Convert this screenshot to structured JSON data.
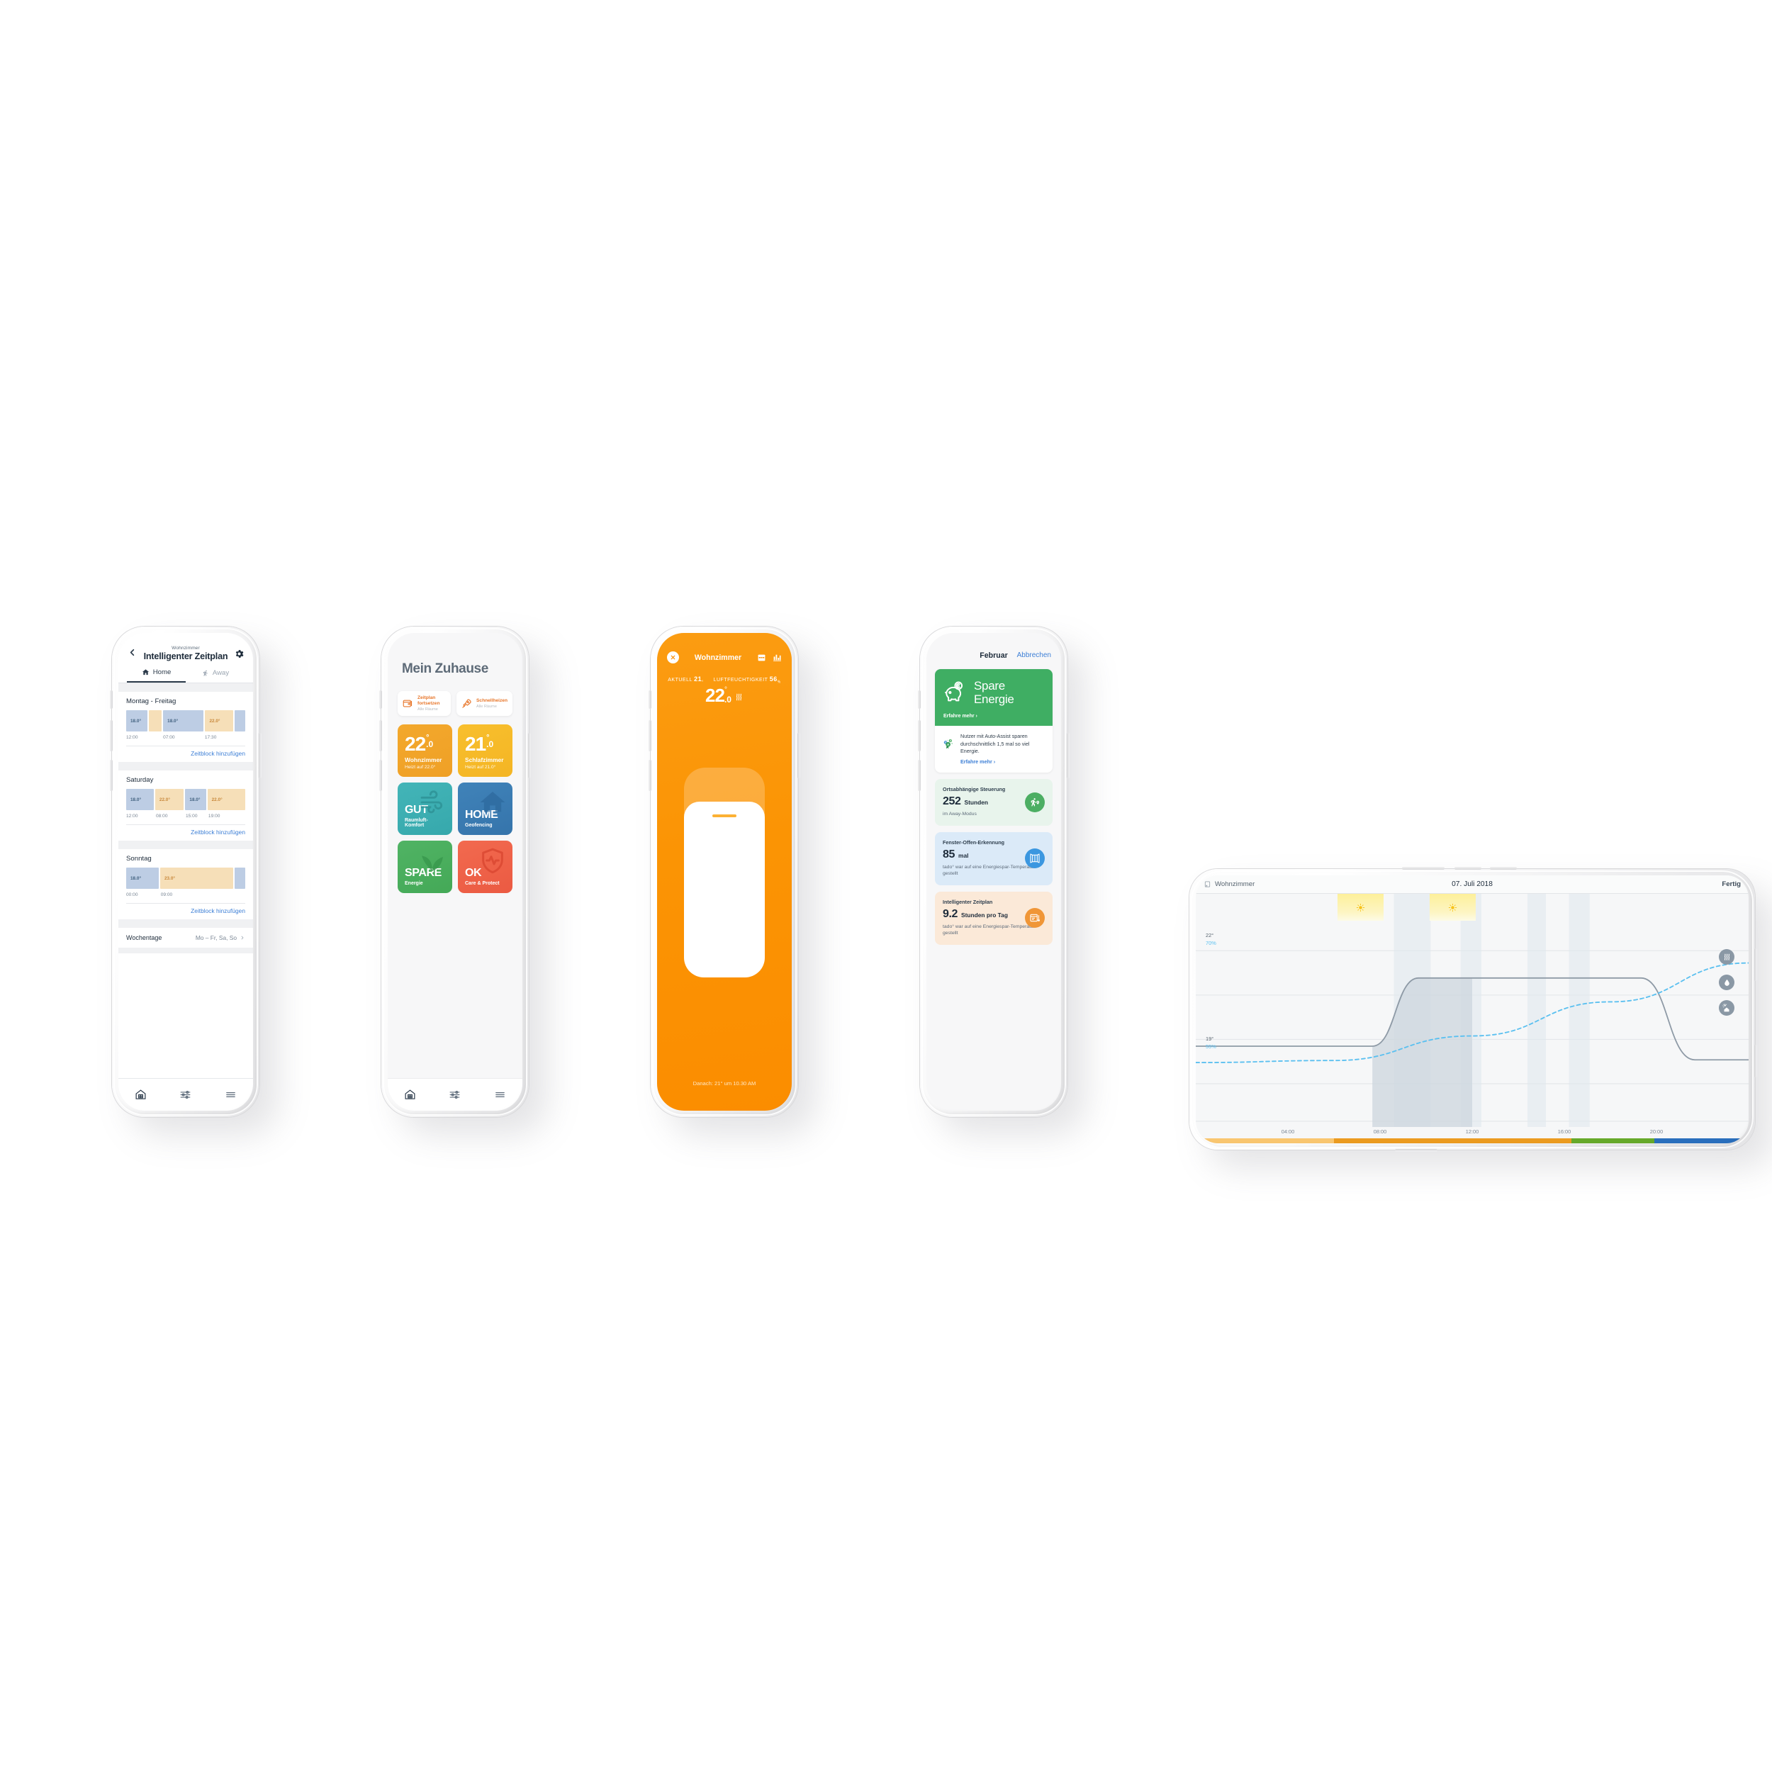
{
  "phone1": {
    "name": "smart-schedule-screen",
    "back_icon": "chevron-left-icon",
    "room": "Wohnzimmer",
    "title": "Intelligenter Zeitplan",
    "settings_icon": "gear-icon",
    "tabs": [
      {
        "label": "Home",
        "icon": "house-icon",
        "active": true
      },
      {
        "label": "Away",
        "icon": "walking-person-icon",
        "active": false
      }
    ],
    "add_block_label": "Zeitblock hinzufügen",
    "days": [
      {
        "day": "Montag - Freitag",
        "blocks": [
          {
            "temp": "18.0°",
            "kind": "cool",
            "width": 19
          },
          {
            "temp": "",
            "kind": "warm",
            "width": 11
          },
          {
            "temp": "18.0°",
            "kind": "cool",
            "width": 36
          },
          {
            "temp": "22.0°",
            "kind": "warm",
            "width": 25
          },
          {
            "temp": "",
            "kind": "cool",
            "width": 9
          }
        ],
        "times": [
          {
            "label": "12:00",
            "pos": 0
          },
          {
            "label": "07:00",
            "pos": 31
          },
          {
            "label": "17:30",
            "pos": 66
          }
        ]
      },
      {
        "day": "Saturday",
        "blocks": [
          {
            "temp": "18.0°",
            "kind": "cool",
            "width": 24
          },
          {
            "temp": "22.0°",
            "kind": "warm",
            "width": 25
          },
          {
            "temp": "18.0°",
            "kind": "cool",
            "width": 18
          },
          {
            "temp": "22.0°",
            "kind": "warm",
            "width": 33
          }
        ],
        "times": [
          {
            "label": "12:00",
            "pos": 0
          },
          {
            "label": "08:00",
            "pos": 25
          },
          {
            "label": "15:00",
            "pos": 50
          },
          {
            "label": "19:00",
            "pos": 69
          }
        ]
      },
      {
        "day": "Sonntag",
        "blocks": [
          {
            "temp": "18.0°",
            "kind": "cool",
            "width": 28
          },
          {
            "temp": "23.0°",
            "kind": "warm",
            "width": 63
          },
          {
            "temp": "",
            "kind": "cool",
            "width": 9
          }
        ],
        "times": [
          {
            "label": "00:00",
            "pos": 0
          },
          {
            "label": "09:00",
            "pos": 29
          }
        ]
      }
    ],
    "weekdays_row": {
      "label": "Wochentage",
      "value": "Mo – Fr, Sa, So",
      "chevron": "chevron-right-icon"
    },
    "tabbar": [
      {
        "icon": "home-building-icon",
        "active": true
      },
      {
        "icon": "sliders-icon",
        "active": false
      },
      {
        "icon": "menu-icon",
        "active": false
      }
    ]
  },
  "phone2": {
    "name": "my-home-screen",
    "title": "Mein Zuhause",
    "quick_actions": [
      {
        "icon": "resume-schedule-icon",
        "title": "Zeitplan fortsetzen",
        "subtitle": "Alle Räume"
      },
      {
        "icon": "rocket-icon",
        "title": "Schnellheizen",
        "subtitle": "Alle Räume"
      }
    ],
    "room_tiles": [
      {
        "temp_int": "22",
        "temp_dec": ".0",
        "deg": "°",
        "room": "Wohnzimmer",
        "sub": "Heizt auf 22.0°",
        "color": "#f2a229"
      },
      {
        "temp_int": "21",
        "temp_dec": ".0",
        "deg": "°",
        "room": "Schlafzimmer",
        "sub": "Heizt auf 21.0°",
        "color": "#f6b928"
      }
    ],
    "mode_tiles": [
      {
        "big": "GUT",
        "sub": "Raumluft-Komfort",
        "color": "#3dafb5",
        "icon": "wind-icon"
      },
      {
        "big": "HOME",
        "sub": "Geofencing",
        "color": "#3b7cb3",
        "icon": "house-filled-icon"
      },
      {
        "big": "SPARE",
        "sub": "Energie",
        "color": "#4cae5f",
        "icon": "leaf-icon"
      },
      {
        "big": "OK",
        "sub": "Care & Protect",
        "color": "#ef6148",
        "icon": "shield-pulse-icon"
      }
    ],
    "tabbar": [
      {
        "icon": "home-building-icon",
        "active": true
      },
      {
        "icon": "sliders-icon",
        "active": false
      },
      {
        "icon": "menu-icon",
        "active": false
      }
    ]
  },
  "phone3": {
    "name": "room-control-screen",
    "close_icon": "close-icon",
    "room": "Wohnzimmer",
    "header_icons": [
      "calendar-icon",
      "bar-chart-icon"
    ],
    "current_label": "AKTUELL",
    "current_value": "21",
    "current_unit": "°",
    "humidity_label": "LUFTFEUCHTIGKEIT",
    "humidity_value": "56",
    "humidity_unit": "%",
    "setpoint_int": "22",
    "setpoint_dec": ".0",
    "setpoint_deg": "°",
    "heating_icon": "heat-waves-icon",
    "footer": "Danach: 21° um 10.30 AM",
    "accent": "#fb8d00"
  },
  "phone4": {
    "name": "energy-report-screen",
    "month": "Februar",
    "cancel_label": "Abbrechen",
    "hero": {
      "icon": "piggy-bank-euro-icon",
      "line1": "Spare",
      "line2": "Energie",
      "more": "Erfahre mehr ›",
      "color": "#3fae63"
    },
    "tip": {
      "icon": "auto-assist-badge-icon",
      "text": "Nutzer mit Auto-Assist sparen durchschnittlich 1,5 mal so viel Energie.",
      "more": "Erfahre mehr ›"
    },
    "stats": [
      {
        "title": "Ortsabhängige Steuerung",
        "value": "252",
        "unit": "Stunden",
        "sub": "im Away-Modus",
        "bg": "#e8f4ec",
        "badge_color": "#4cae63",
        "icon": "geofencing-icon"
      },
      {
        "title": "Fenster-Offen-Erkennung",
        "value": "85",
        "unit": "mal",
        "sub": "tado° war auf eine Energiespar-Temperatur gestellt",
        "bg": "#dbeaf8",
        "badge_color": "#3b97e0",
        "icon": "open-window-icon"
      },
      {
        "title": "Intelligenter Zeitplan",
        "value": "9.2",
        "unit": "Stunden pro Tag",
        "sub": "tado° war auf eine Energiespar-Temperatur gestellt",
        "bg": "#fbe9d8",
        "badge_color": "#f09637",
        "icon": "schedule-thermometer-icon"
      }
    ]
  },
  "phone5": {
    "name": "day-report-landscape-screen",
    "room_icon": "device-icon",
    "room": "Wohnzimmer",
    "date": "07. Juli 2018",
    "done_label": "Fertig",
    "side_icons": [
      "heating-waves-icon",
      "humidity-drop-icon",
      "weather-house-icon"
    ],
    "chart_data": {
      "type": "line",
      "title": "07. Juli 2018",
      "xlabel": "",
      "ylabel": "",
      "grid": true,
      "legend": "right-icons",
      "x": [
        "00:00",
        "04:00",
        "08:00",
        "12:00",
        "16:00",
        "20:00",
        "24:00"
      ],
      "xticks": [
        "04:00",
        "08:00",
        "12:00",
        "16:00",
        "20:00"
      ],
      "y_axis_labels": [
        {
          "temp": "22°",
          "humidity": "70%"
        },
        {
          "temp": "19°",
          "humidity": "55%"
        }
      ],
      "ylim_temp": [
        18,
        23
      ],
      "ylim_humidity": [
        50,
        75
      ],
      "series": [
        {
          "name": "Solltemperatur",
          "type": "step-area",
          "color": "#8e9aa6",
          "fill": "#ccd6de",
          "points": [
            {
              "t": "00:00",
              "v": 19.6
            },
            {
              "t": "07:40",
              "v": 19.6
            },
            {
              "t": "09:40",
              "v": 21.6
            },
            {
              "t": "19:20",
              "v": 21.6
            },
            {
              "t": "21:40",
              "v": 19.2
            },
            {
              "t": "24:00",
              "v": 19.2
            }
          ]
        },
        {
          "name": "Luftfeuchtigkeit",
          "type": "dashed-line",
          "color": "#5bc0f0",
          "points": [
            {
              "t": "00:00",
              "v": 55.6
            },
            {
              "t": "06:00",
              "v": 55.9
            },
            {
              "t": "12:00",
              "v": 59.5
            },
            {
              "t": "18:00",
              "v": 64.5
            },
            {
              "t": "24:00",
              "v": 70.2
            }
          ]
        }
      ],
      "sun_markers": [
        {
          "start": "06:10",
          "end": "08:10",
          "icon": "sun-icon"
        },
        {
          "start": "10:10",
          "end": "12:10",
          "icon": "sun-icon"
        }
      ],
      "mode_bar": [
        {
          "color": "#f9c670",
          "from": 0,
          "to": 25
        },
        {
          "color": "#eb9b20",
          "from": 25,
          "to": 68
        },
        {
          "color": "#66a92a",
          "from": 68,
          "to": 83
        },
        {
          "color": "#2a6fbd",
          "from": 83,
          "to": 100
        }
      ]
    }
  }
}
